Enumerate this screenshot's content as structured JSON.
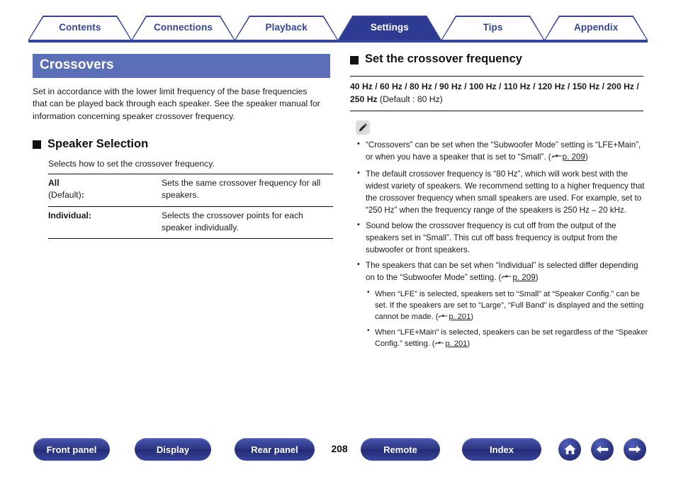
{
  "tabs": [
    {
      "label": "Contents",
      "active": false
    },
    {
      "label": "Connections",
      "active": false
    },
    {
      "label": "Playback",
      "active": false
    },
    {
      "label": "Settings",
      "active": true
    },
    {
      "label": "Tips",
      "active": false
    },
    {
      "label": "Appendix",
      "active": false
    }
  ],
  "page": {
    "title": "Crossovers",
    "intro": "Set in accordance with the lower limit frequency of the base frequencies that can be played back through each speaker. See the speaker manual for information concerning speaker crossover frequency.",
    "number": "208"
  },
  "speaker_selection": {
    "heading": "Speaker Selection",
    "marker_icon": "black-square-icon",
    "description": "Selects how to set the crossover frequency.",
    "rows": [
      {
        "term": "All",
        "term_default": "(Default)",
        "term_colon": ":",
        "definition": "Sets the same crossover frequency for all speakers."
      },
      {
        "term": "Individual",
        "term_default": "",
        "term_colon": ":",
        "definition": "Selects the crossover points for each speaker individually."
      }
    ]
  },
  "crossover_frequency": {
    "heading": "Set the crossover frequency",
    "marker_icon": "black-square-icon",
    "frequency_list": "40 Hz / 60 Hz / 80 Hz / 90 Hz / 100 Hz / 110 Hz / 120 Hz / 150 Hz / 200 Hz / 250 Hz",
    "default_note": " (Default : 80 Hz)"
  },
  "note_block": {
    "icon": "pencil-icon",
    "items": [
      {
        "text": "“Crossovers” can be set when the “Subwoofer Mode” setting is “LFE+Main”, or when you have a speaker that is set to “Small”.  (",
        "link": "p. 209",
        "text_after": ")"
      },
      {
        "text": "The default crossover frequency is “80 Hz”, which will work best with the widest variety of speakers. We recommend setting to a higher frequency that the crossover frequency when small speakers are used. For example, set to “250 Hz” when the frequency range of the speakers is 250 Hz – 20 kHz.",
        "link": "",
        "text_after": ""
      },
      {
        "text": "Sound below the crossover frequency is cut off from the output of the speakers set in “Small”. This cut off bass frequency is output from the subwoofer or front speakers.",
        "link": "",
        "text_after": ""
      },
      {
        "text": "The speakers that can be set when “Individual” is selected differ depending on to the “Subwoofer Mode” setting.  (",
        "link": "p. 209",
        "text_after": ")"
      }
    ],
    "subitems": [
      {
        "text": "When “LFE” is selected, speakers set to “Small” at “Speaker Config.” can be set. If the speakers are set to “Large”, “Full Band” is displayed and the setting cannot be made.  (",
        "link": "p. 201",
        "text_after": ")"
      },
      {
        "text": "When “LFE+Main” is selected, speakers can be set regardless of the “Speaker Config.” setting.  (",
        "link": "p. 201",
        "text_after": ")"
      }
    ]
  },
  "footer": {
    "buttons": [
      {
        "label": "Front panel"
      },
      {
        "label": "Display"
      },
      {
        "label": "Rear panel"
      },
      {
        "label": "Remote"
      },
      {
        "label": "Index"
      }
    ],
    "icons": [
      {
        "name": "home-icon"
      },
      {
        "name": "arrow-left-icon"
      },
      {
        "name": "arrow-right-icon"
      }
    ]
  },
  "colors": {
    "brand_blue": "#34459b",
    "active_tab": "#2d3c92",
    "title_banner": "#5b6fb8",
    "text": "#1a1a1a"
  }
}
